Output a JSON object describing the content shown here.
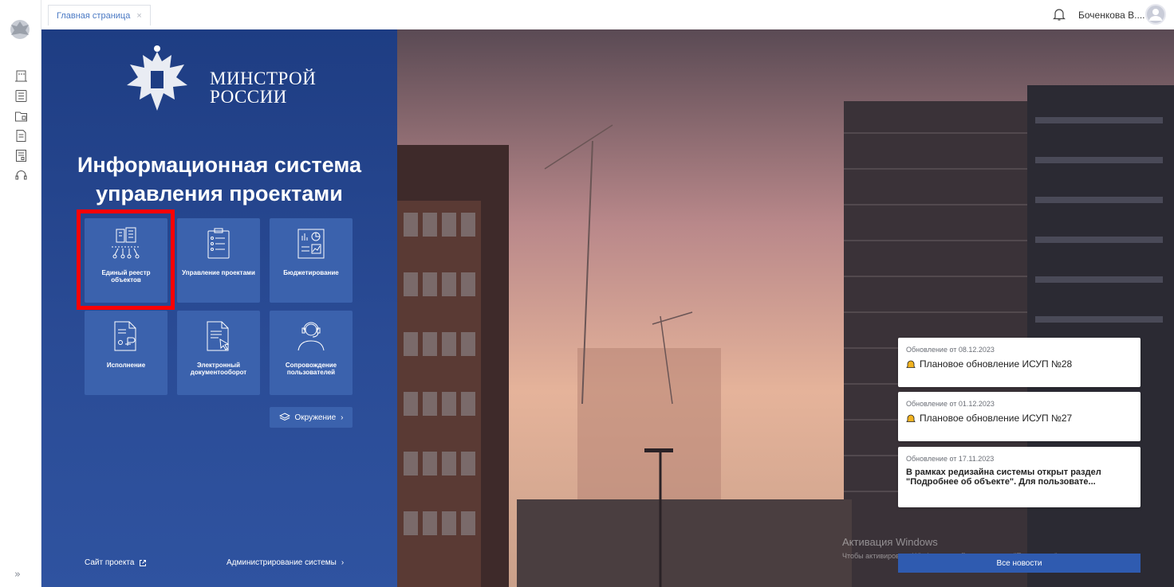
{
  "tab": {
    "label": "Главная страница",
    "close": "×"
  },
  "user": {
    "name": "Боченкова В...."
  },
  "logo": {
    "line1": "МИНСТРОЙ",
    "line2": "РОССИИ"
  },
  "title": {
    "line1": "Информационная система",
    "line2": "управления проектами"
  },
  "tiles": [
    {
      "label": "Единый реестр объектов",
      "icon": "registry-icon"
    },
    {
      "label": "Управление проектами",
      "icon": "checklist-icon"
    },
    {
      "label": "Бюджетирование",
      "icon": "budget-chart-icon"
    },
    {
      "label": "Исполнение",
      "icon": "document-stamp-icon"
    },
    {
      "label": "Электронный документооборот",
      "icon": "document-cursor-icon"
    },
    {
      "label": "Сопровождение пользователей",
      "icon": "support-headset-icon"
    }
  ],
  "environment_button": {
    "label": "Окружение"
  },
  "footer": {
    "site_link": "Сайт проекта",
    "admin_link": "Администрирование системы"
  },
  "news": [
    {
      "date": "Обновление  от  08.12.2023",
      "title": "Плановое обновление ИСУП №28"
    },
    {
      "date": "Обновление  от  01.12.2023",
      "title": "Плановое обновление ИСУП №27"
    },
    {
      "date": "Обновление  от  17.11.2023",
      "title": "В рамках редизайна системы открыт раздел \"Подробнее об объекте\". Для пользовате..."
    }
  ],
  "all_news": "Все новости",
  "watermark": {
    "title": "Активация Windows",
    "subtitle": "Чтобы активировать Windows, перейдите в раздел \"Параметры\"."
  },
  "colors": {
    "panel": "#1e3d83",
    "tile": "#3b62ad",
    "highlight": "#ff0000",
    "bell": "#f2b320",
    "accent": "#2f5bb0"
  }
}
